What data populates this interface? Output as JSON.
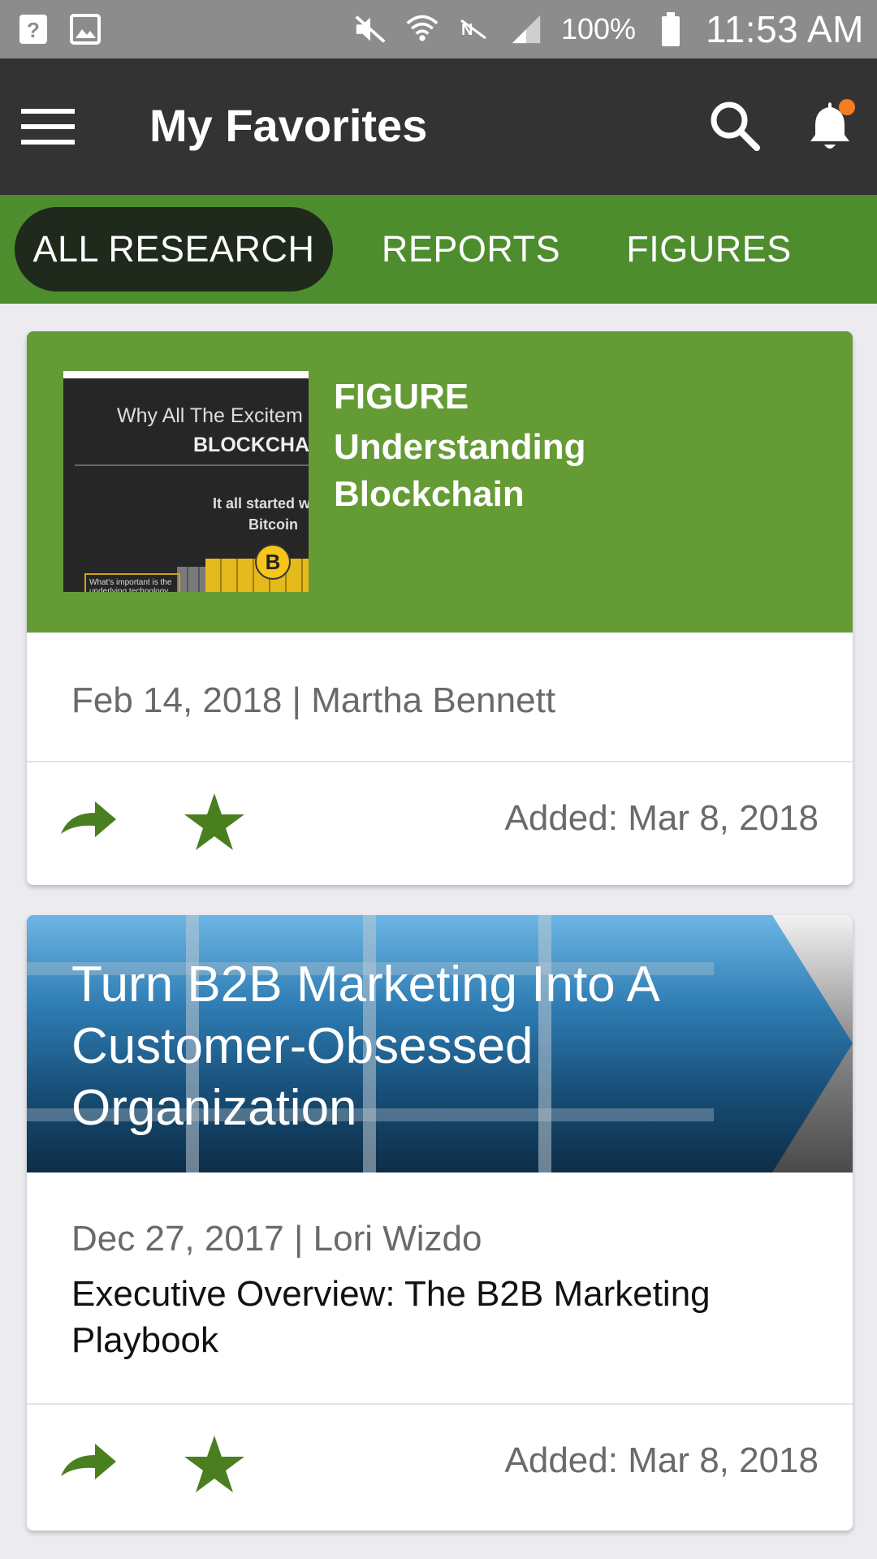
{
  "status_bar": {
    "battery_percent": "100%",
    "time": "11:53 AM",
    "icons": [
      "help-icon",
      "image-icon",
      "mute-icon",
      "wifi-icon",
      "nfc-off-icon",
      "signal-icon",
      "battery-icon"
    ]
  },
  "app_bar": {
    "title": "My Favorites",
    "icons": [
      "menu-icon",
      "search-icon",
      "bell-icon"
    ],
    "notification_dot_color": "#f57c20"
  },
  "tabs": [
    {
      "label": "ALL RESEARCH",
      "active": true
    },
    {
      "label": "REPORTS",
      "active": false
    },
    {
      "label": "FIGURES",
      "active": false
    }
  ],
  "cards": [
    {
      "type_label": "FIGURE",
      "title": "Understanding Blockchain",
      "thumbnail": {
        "line1": "Why All The Excitem",
        "line2": "BLOCKCHA",
        "line3": "It all started w",
        "line4": "Bitcoin",
        "coin": "B",
        "box": "What's important is the underlying technology."
      },
      "meta": "Feb 14, 2018 | Martha Bennett",
      "added": "Added: Mar 8, 2018"
    },
    {
      "header_title": "Turn B2B Marketing Into A Customer-Obsessed Organization",
      "meta": "Dec 27, 2017 | Lori Wizdo",
      "description": "Executive Overview: The B2B Marketing Playbook",
      "added": "Added: Mar 8, 2018"
    }
  ],
  "colors": {
    "status_bar": "#8c8c8c",
    "app_bar": "#333333",
    "tab_bar": "#4e8d2e",
    "active_tab": "#1f2a1c",
    "card_header_green": "#659b35",
    "action_green": "#4a7f1f"
  }
}
